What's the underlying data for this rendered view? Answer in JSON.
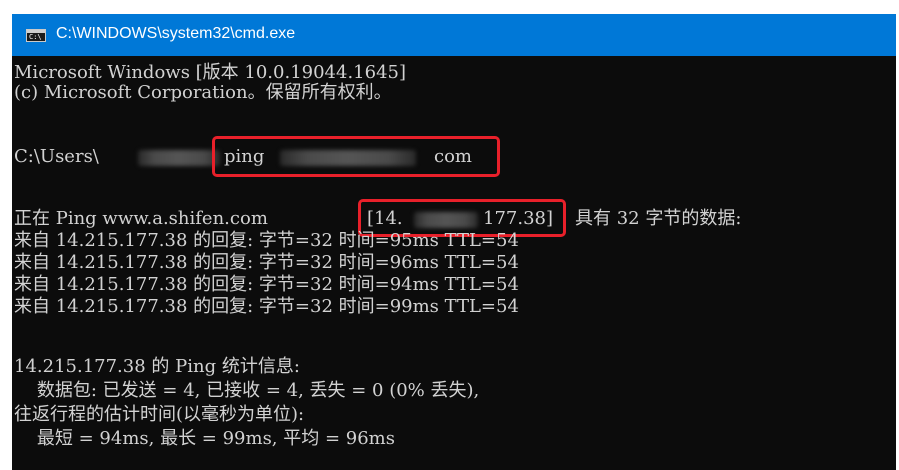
{
  "window": {
    "title": "C:\\WINDOWS\\system32\\cmd.exe",
    "icon": "cmd-console-icon",
    "icon_prompt": "C:\\"
  },
  "console": {
    "header_line1": "Microsoft Windows [版本 10.0.19044.1645]",
    "header_line2": "(c) Microsoft Corporation。保留所有权利。",
    "prompt_prefix": "C:\\Users\\",
    "command": "ping",
    "command_suffix": "com",
    "ping_intro": "正在 Ping www.a.shifen.com",
    "ip_open": "[14.",
    "ip_close": "177.38]",
    "ping_intro_suffix": "具有 32 字节的数据:",
    "replies": [
      "来自 14.215.177.38 的回复: 字节=32 时间=95ms TTL=54",
      "来自 14.215.177.38 的回复: 字节=32 时间=96ms TTL=54",
      "来自 14.215.177.38 的回复: 字节=32 时间=94ms TTL=54",
      "来自 14.215.177.38 的回复: 字节=32 时间=99ms TTL=54"
    ],
    "stats_header": "14.215.177.38 的 Ping 统计信息:",
    "stats_packets": "    数据包: 已发送 = 4, 已接收 = 4, 丢失 = 0 (0% 丢失),",
    "rtt_header": "往返行程的估计时间(以毫秒为单位):",
    "rtt_values": "    最短 = 94ms, 最长 = 99ms, 平均 = 96ms"
  },
  "colors": {
    "titlebar": "#0078d7",
    "console_bg": "#0c0c0c",
    "console_text": "#d2d2d2",
    "annotation": "#e8202a"
  }
}
